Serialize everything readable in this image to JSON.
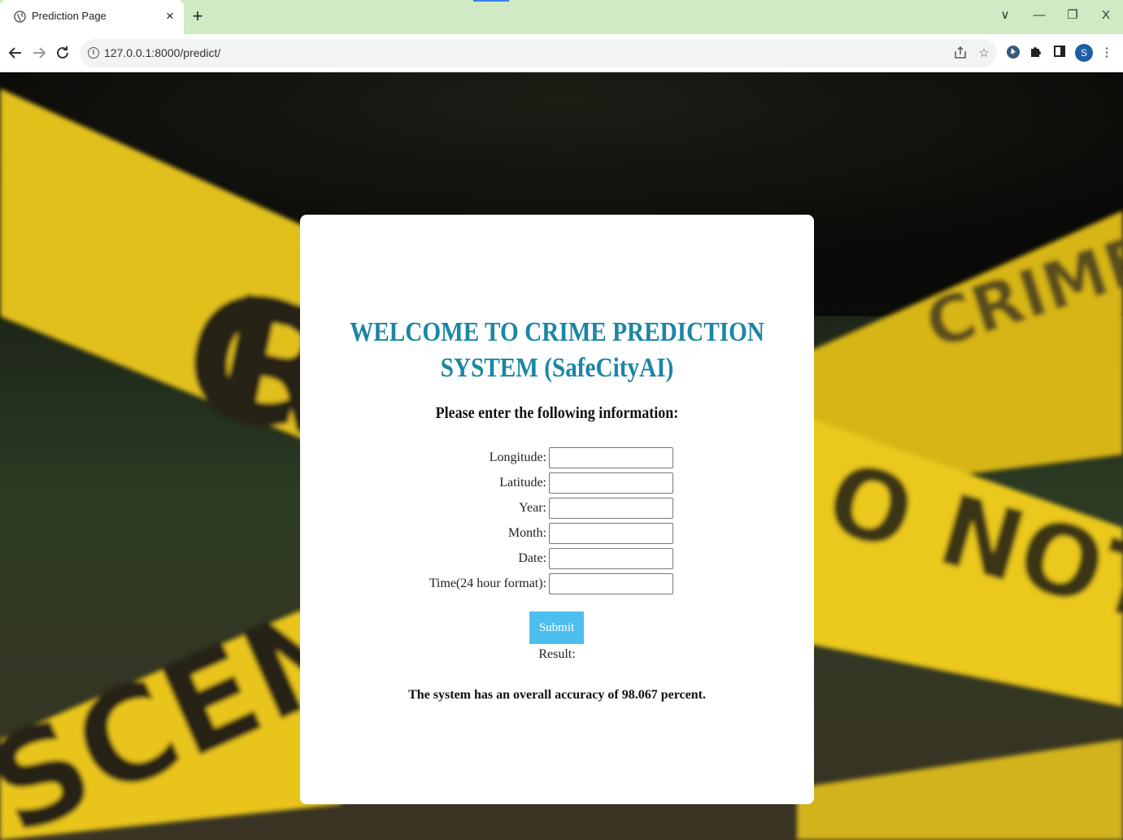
{
  "browser": {
    "tab_title": "Prediction Page",
    "tab_close": "×",
    "new_tab": "+",
    "url": "127.0.0.1:8000/predict/",
    "profile_initial": "S",
    "window_controls": {
      "dropdown": "∨",
      "minimize": "—",
      "restore": "❐",
      "close": "X"
    }
  },
  "icons": {
    "favicon": "globe-icon",
    "back": "back-arrow-icon",
    "forward": "forward-arrow-icon",
    "reload": "reload-icon",
    "site_info": "info-icon",
    "share": "share-icon",
    "bookmark": "star-icon",
    "extension": "extension-icon",
    "puzzle": "puzzle-icon",
    "sidepanel": "side-panel-icon",
    "menu": "kebab-menu-icon"
  },
  "page": {
    "title": "WELCOME TO CRIME PREDICTION SYSTEM (SafeCityAI)",
    "subtitle": "Please enter the following information:",
    "fields": [
      {
        "label": "Longitude:",
        "value": ""
      },
      {
        "label": "Latitude:",
        "value": ""
      },
      {
        "label": "Year:",
        "value": ""
      },
      {
        "label": "Month:",
        "value": ""
      },
      {
        "label": "Date:",
        "value": ""
      },
      {
        "label": "Time(24 hour format):",
        "value": ""
      }
    ],
    "submit_label": "Submit",
    "result_label": "Result:",
    "accuracy_text": "The system has an overall accuracy of 98.067 percent.",
    "background_tape_text": [
      "CRIME SCENE",
      "DO NOT CROSS"
    ]
  },
  "colors": {
    "title": "#1b86a6",
    "submit_button": "#4dbfee",
    "tab_strip": "#cfeac4",
    "tape_yellow": "#e8c417",
    "profile": "#1a5fa8"
  }
}
